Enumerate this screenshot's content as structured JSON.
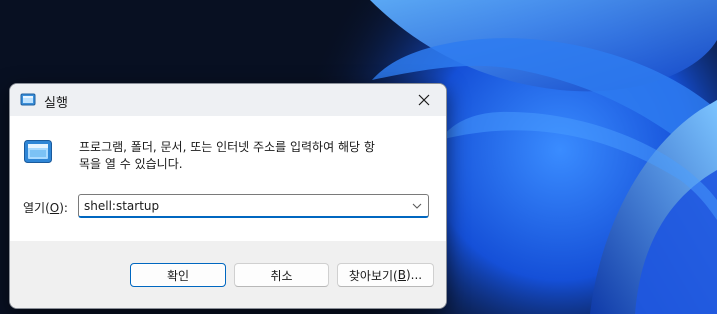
{
  "dialog": {
    "title": "실행",
    "description": "프로그램, 폴더, 문서, 또는 인터넷 주소를 입력하여 해당 항\n목을 열 수 있습니다.",
    "open_label_prefix": "열기(",
    "open_label_mnemonic": "O",
    "open_label_suffix": "):",
    "command_value": "shell:startup",
    "buttons": {
      "ok": "확인",
      "cancel": "취소",
      "browse_prefix": "찾아보기(",
      "browse_mnemonic": "B",
      "browse_suffix": ")..."
    },
    "icons": {
      "title": "run-icon",
      "body": "run-icon",
      "close": "close-icon",
      "dropdown": "chevron-down-icon"
    }
  },
  "colors": {
    "accent": "#0067c0",
    "wallpaper_dark": "#0a1126",
    "wallpaper_blue": "#1a5ef0"
  }
}
